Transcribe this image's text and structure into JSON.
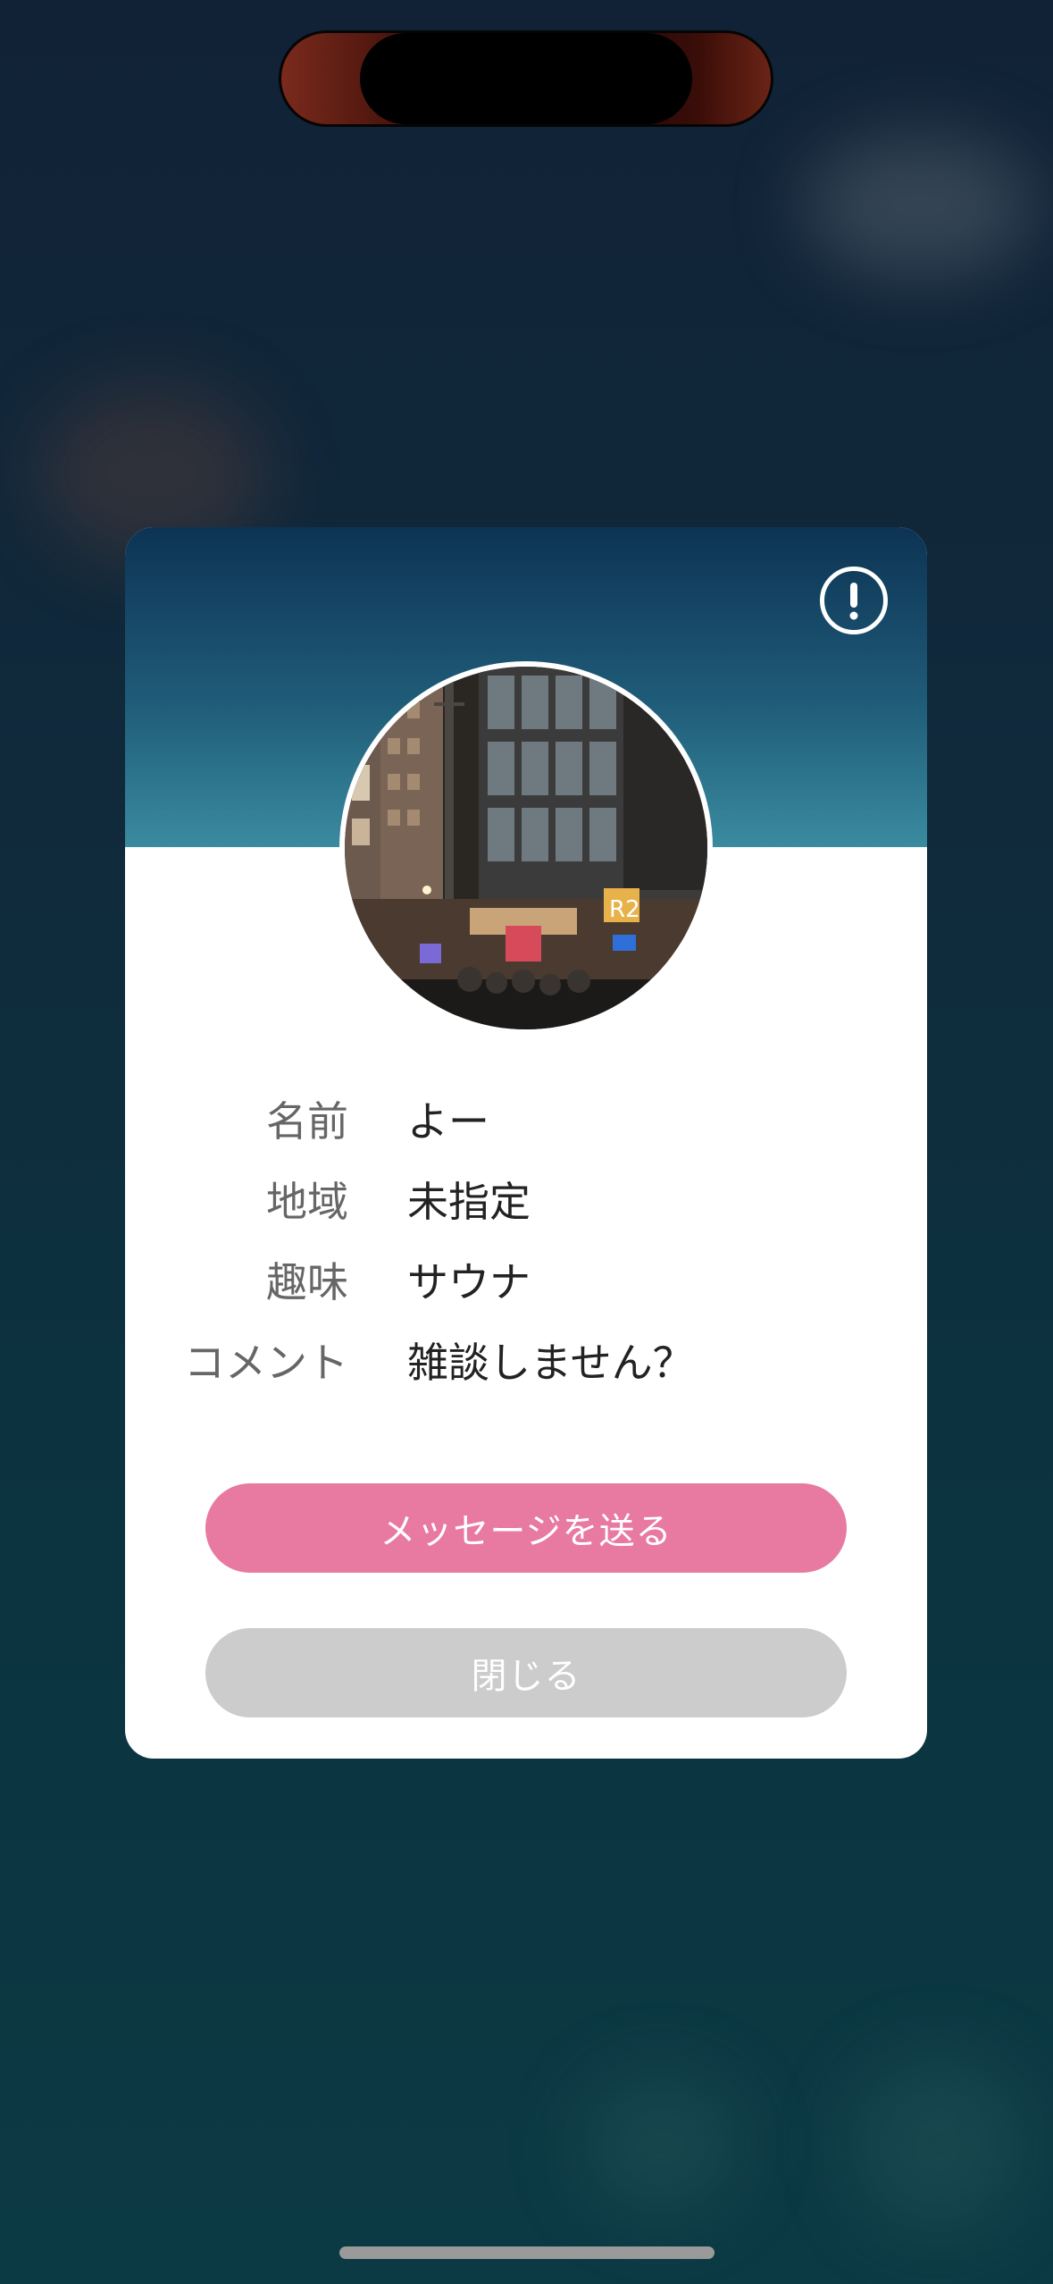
{
  "colors": {
    "header_gradient_top": "#0d3354",
    "header_gradient_bottom": "#3a8ba0",
    "message_button": "#e879a1",
    "close_button": "#cccccc",
    "label_text": "#666666",
    "value_text": "#222222"
  },
  "profile_card": {
    "report_icon": "exclamation-circle-icon",
    "avatar": "city-night-street-photo",
    "fields": [
      {
        "label": "名前",
        "value": "よー"
      },
      {
        "label": "地域",
        "value": "未指定"
      },
      {
        "label": "趣味",
        "value": "サウナ"
      },
      {
        "label": "コメント",
        "value": "雑談しません？"
      }
    ],
    "send_message_label": "メッセージを送る",
    "close_label": "閉じる"
  }
}
